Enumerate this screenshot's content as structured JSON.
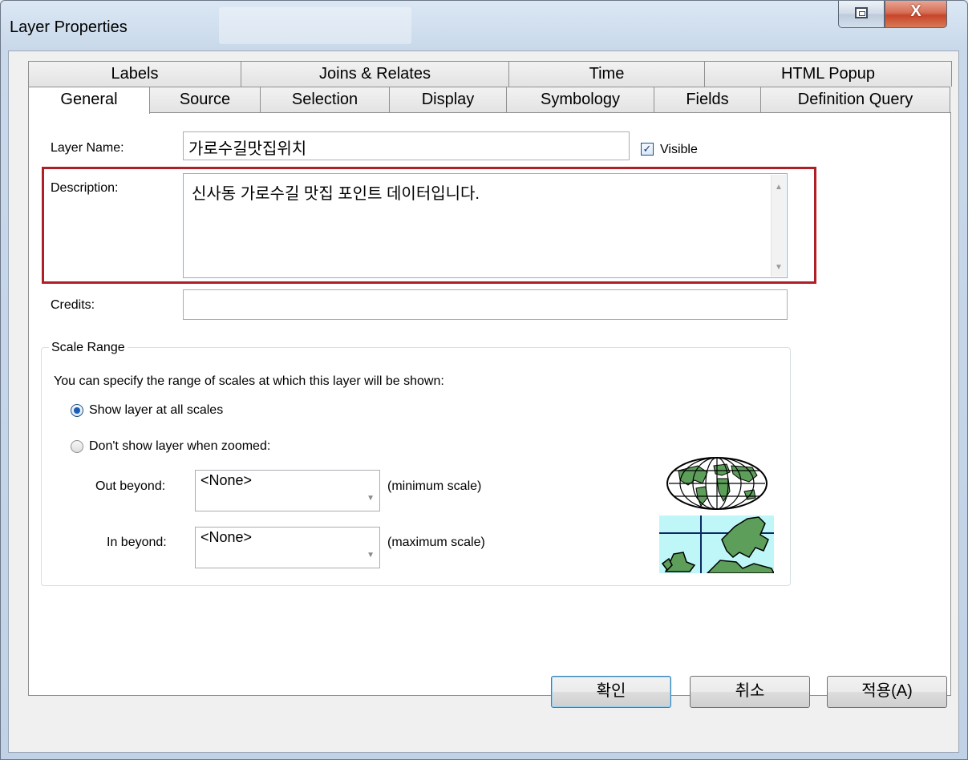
{
  "window": {
    "title": "Layer Properties",
    "close_symbol": "X"
  },
  "tabs": {
    "back_row": [
      "Labels",
      "Joins & Relates",
      "Time",
      "HTML Popup"
    ],
    "front_row": [
      "General",
      "Source",
      "Selection",
      "Display",
      "Symbology",
      "Fields",
      "Definition Query"
    ],
    "active": "General"
  },
  "general": {
    "layer_name_label": "Layer Name:",
    "layer_name_value": "가로수길맛집위치",
    "visible_label": "Visible",
    "visible_checked": true,
    "description_label": "Description:",
    "description_value": "신사동 가로수길 맛집 포인트 데이터입니다.",
    "credits_label": "Credits:",
    "credits_value": ""
  },
  "scale_range": {
    "title": "Scale Range",
    "instructions": "You can specify the range of scales at which this layer will be shown:",
    "option_all": "Show layer at all scales",
    "option_zoomed": "Don't show layer when zoomed:",
    "selected": "all",
    "out_beyond_label": "Out beyond:",
    "out_beyond_value": "<None>",
    "out_beyond_note": "(minimum scale)",
    "in_beyond_label": "In beyond:",
    "in_beyond_value": "<None>",
    "in_beyond_note": "(maximum scale)"
  },
  "buttons": {
    "ok": "확인",
    "cancel": "취소",
    "apply": "적용(A)"
  },
  "icons": [
    "restore-icon",
    "close-icon",
    "checkbox-checked-icon",
    "scroll-up-icon",
    "scroll-down-icon",
    "dropdown-arrow-icon",
    "world-globe-icon",
    "zoomed-map-icon"
  ],
  "colors": {
    "highlight_border": "#b01e26",
    "close_button": "#c7452b",
    "map_land": "#5d9e5a",
    "map_water": "#bff7f9"
  }
}
